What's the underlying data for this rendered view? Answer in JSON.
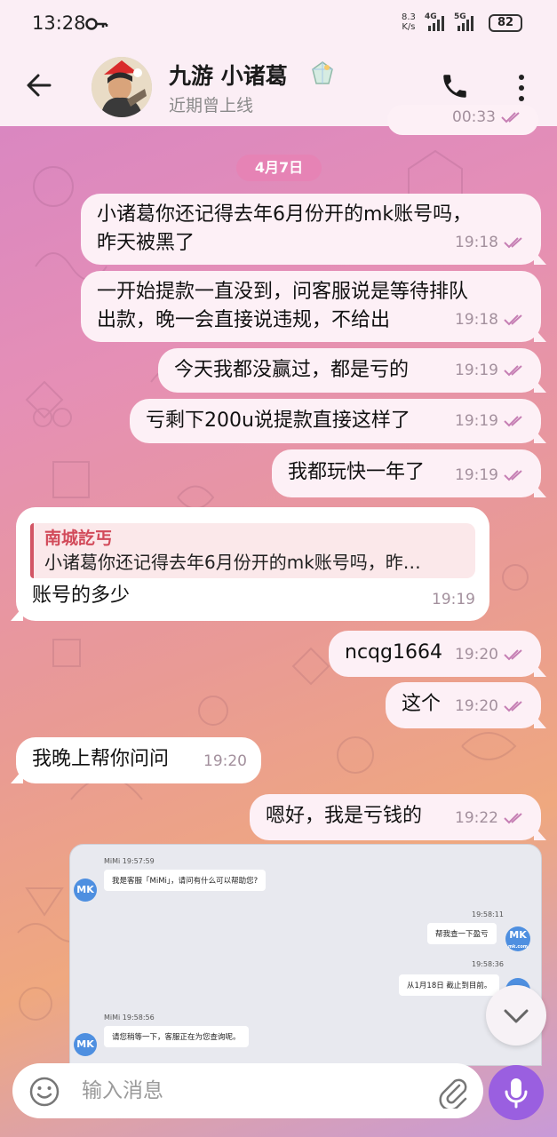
{
  "status_bar": {
    "time": "13:28",
    "speed_value": "8.3",
    "speed_unit": "K/s",
    "net1": "4G",
    "net2": "5G",
    "battery": "82"
  },
  "header": {
    "title": "九游 小诸葛",
    "subtitle": "近期曾上线"
  },
  "chat": {
    "partial_time": "00:33",
    "date_separator": "4月7日",
    "messages": [
      {
        "lines": [
          "小诸葛你还记得去年6月份开的mk账号吗，",
          "昨天被黑了"
        ],
        "time": "19:18"
      },
      {
        "lines": [
          "一开始提款一直没到，问客服说是等待排队",
          "出款，晚一会直接说违规，不给出"
        ],
        "time": "19:18"
      },
      {
        "lines": [
          "今天我都没赢过，都是亏的"
        ],
        "time": "19:19"
      },
      {
        "lines": [
          "亏剩下200u说提款直接这样了"
        ],
        "time": "19:19"
      },
      {
        "lines": [
          "我都玩快一年了"
        ],
        "time": "19:19"
      },
      {
        "reply_name": "南城訖丐",
        "reply_text": "小诸葛你还记得去年6月份开的mk账号吗，昨…",
        "lines": [
          "账号的多少"
        ],
        "time": "19:19"
      },
      {
        "lines": [
          "ncqg1664"
        ],
        "time": "19:20"
      },
      {
        "lines": [
          "这个"
        ],
        "time": "19:20"
      },
      {
        "lines": [
          "我晚上帮你问问"
        ],
        "time": "19:20"
      },
      {
        "lines": [
          "嗯好，我是亏钱的"
        ],
        "time": "19:22"
      }
    ],
    "screenshot": {
      "agent_label_1": "MiMi 19:57:59",
      "agent_msg_1": "我是客服「MiMi」，请问有什么可以帮助您?",
      "user_time_1": "19:58:11",
      "user_msg_1": "帮我查一下盈亏",
      "user_time_2": "19:58:36",
      "user_msg_2": "从1月18日 截止到目前。",
      "agent_label_2": "MiMi 19:58:56",
      "agent_msg_2": "请您稍等一下，客服正在为您查询呢。",
      "avatar_text": "MK",
      "avatar_sub": "mk.com"
    }
  },
  "input": {
    "placeholder": "输入消息"
  }
}
